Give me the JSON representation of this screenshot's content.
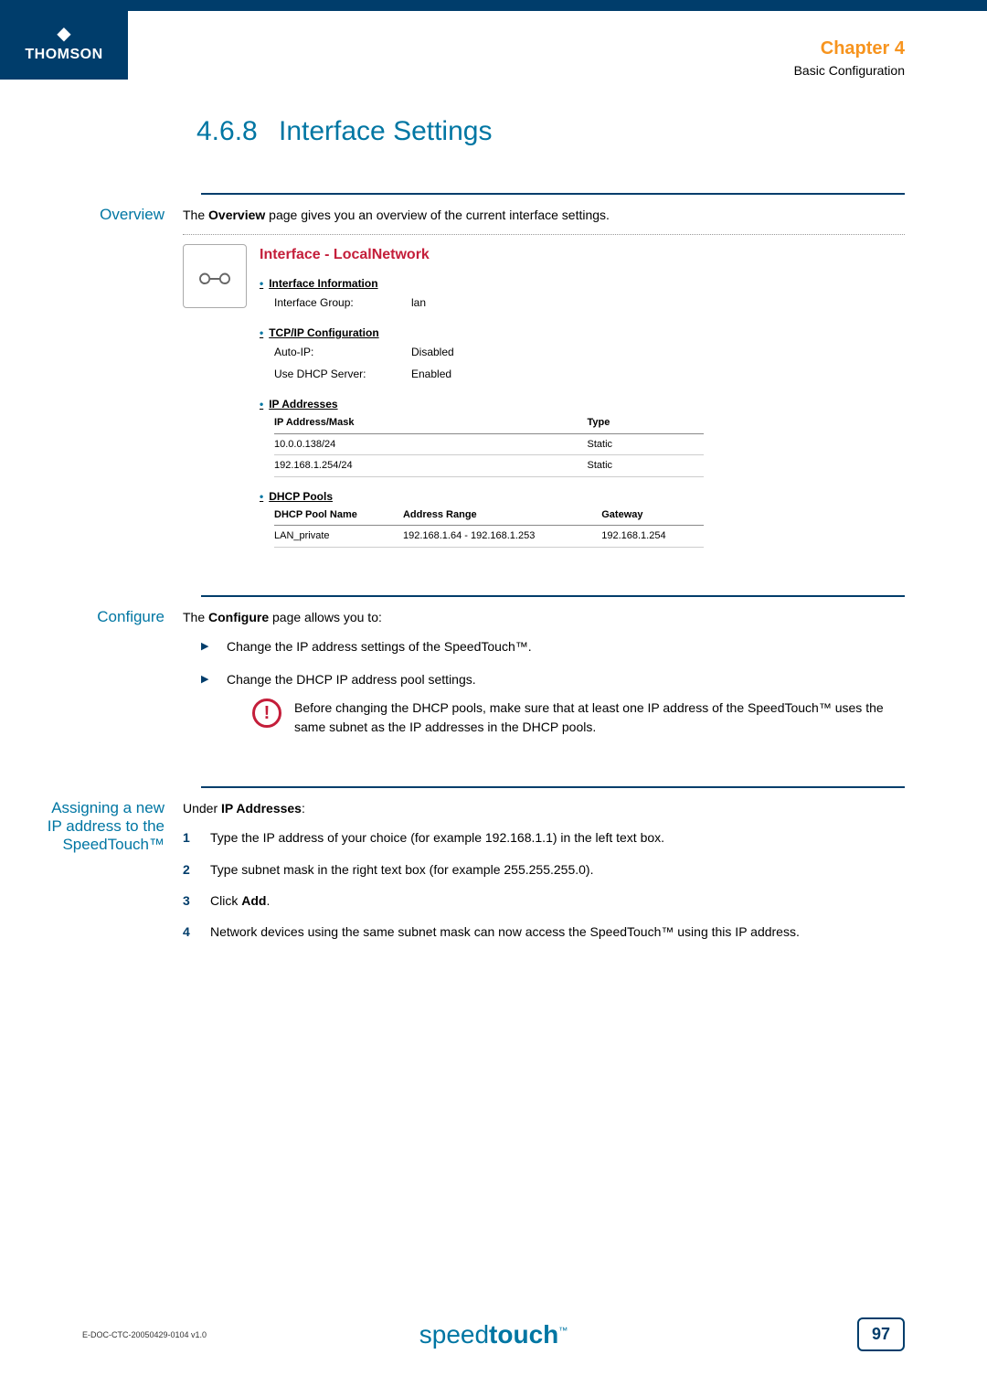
{
  "brand": {
    "logo_text": "THOMSON",
    "footer_product_light": "speed",
    "footer_product_bold": "touch",
    "footer_tm": "™"
  },
  "chapter": {
    "label": "Chapter 4",
    "subtitle": "Basic Configuration"
  },
  "section": {
    "number": "4.6.8",
    "title": "Interface Settings"
  },
  "overview": {
    "label": "Overview",
    "intro_before": "The ",
    "intro_bold": "Overview",
    "intro_after": " page gives you an overview of the current interface settings.",
    "panel": {
      "title": "Interface - LocalNetwork",
      "interface_info_heading": "Interface Information",
      "interface_group_label": "Interface Group:",
      "interface_group_value": "lan",
      "tcpip_heading": "TCP/IP Configuration",
      "auto_ip_label": "Auto-IP:",
      "auto_ip_value": "Disabled",
      "dhcp_server_label": "Use DHCP Server:",
      "dhcp_server_value": "Enabled",
      "ip_addresses_heading": "IP Addresses",
      "ip_table": {
        "col_address": "IP Address/Mask",
        "col_type": "Type",
        "rows": [
          {
            "address": "10.0.0.138/24",
            "type": "Static"
          },
          {
            "address": "192.168.1.254/24",
            "type": "Static"
          }
        ]
      },
      "dhcp_pools_heading": "DHCP Pools",
      "dhcp_table": {
        "col_name": "DHCP Pool Name",
        "col_range": "Address Range",
        "col_gateway": "Gateway",
        "rows": [
          {
            "name": "LAN_private",
            "range": "192.168.1.64 - 192.168.1.253",
            "gateway": "192.168.1.254"
          }
        ]
      }
    }
  },
  "configure": {
    "label": "Configure",
    "intro_before": "The ",
    "intro_bold": "Configure",
    "intro_after": " page allows you to:",
    "bullet1": "Change the IP address settings of the SpeedTouch™.",
    "bullet2": "Change the DHCP IP address pool settings.",
    "warning": "Before changing the DHCP pools, make sure that at least one IP address of the SpeedTouch™ uses the same subnet as the IP addresses in the DHCP pools."
  },
  "assigning": {
    "label": "Assigning a new IP address to the SpeedTouch™",
    "intro_before": "Under ",
    "intro_bold": "IP Addresses",
    "intro_after": ":",
    "steps": [
      "Type the IP address of your choice (for example 192.168.1.1) in the left text box.",
      "Type subnet mask in the right text box (for example 255.255.255.0).",
      {
        "before": "Click ",
        "bold": "Add",
        "after": "."
      },
      "Network devices using the same subnet mask can now access the SpeedTouch™ using this IP address."
    ]
  },
  "footer": {
    "doc_id": "E-DOC-CTC-20050429-0104 v1.0",
    "page": "97"
  }
}
